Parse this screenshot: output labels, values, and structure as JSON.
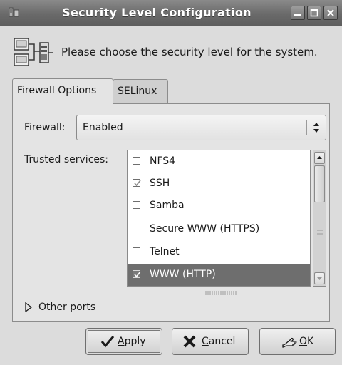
{
  "window": {
    "title": "Security Level Configuration",
    "controls": [
      "minimize",
      "maximize",
      "close"
    ]
  },
  "header": {
    "icon": "network-computers-icon",
    "text": "Please choose the security level for the system."
  },
  "tabs": [
    {
      "label": "Firewall Options",
      "active": true
    },
    {
      "label": "SELinux",
      "active": false
    }
  ],
  "firewall": {
    "label": "Firewall:",
    "value": "Enabled"
  },
  "trusted": {
    "label": "Trusted services:",
    "items": [
      {
        "label": "NFS4",
        "checked": false,
        "selected": false
      },
      {
        "label": "SSH",
        "checked": true,
        "selected": false
      },
      {
        "label": "Samba",
        "checked": false,
        "selected": false
      },
      {
        "label": "Secure WWW (HTTPS)",
        "checked": false,
        "selected": false
      },
      {
        "label": "Telnet",
        "checked": false,
        "selected": false
      },
      {
        "label": "WWW (HTTP)",
        "checked": true,
        "selected": true
      }
    ]
  },
  "other_ports": {
    "label": "Other ports"
  },
  "buttons": {
    "apply": "Apply",
    "cancel": "Cancel",
    "ok": "OK"
  },
  "colors": {
    "selection": "#6e6e6e",
    "background": "#dcdcdc"
  }
}
